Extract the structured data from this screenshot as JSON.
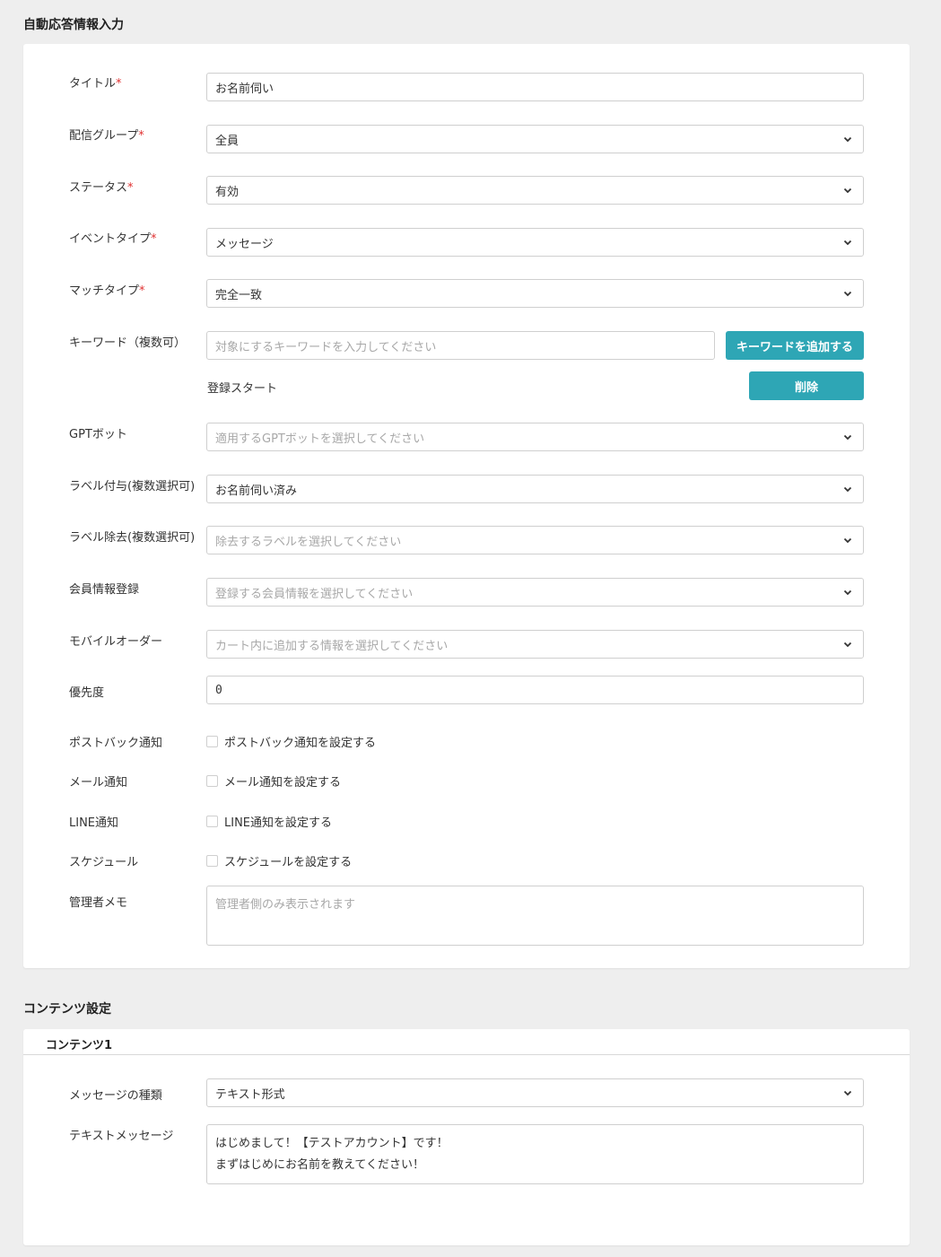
{
  "section1": {
    "title": "自動応答情報入力",
    "title_label": "タイトル",
    "title_value": "お名前伺い",
    "group_label": "配信グループ",
    "group_value": "全員",
    "status_label": "ステータス",
    "status_value": "有効",
    "event_label": "イベントタイプ",
    "event_value": "メッセージ",
    "match_label": "マッチタイプ",
    "match_value": "完全一致",
    "keyword_label": "キーワード（複数可）",
    "keyword_placeholder": "対象にするキーワードを入力してください",
    "keyword_add_button": "キーワードを追加する",
    "keyword_item": "登録スタート",
    "keyword_delete_button": "削除",
    "gpt_label": "GPTボット",
    "gpt_placeholder": "適用するGPTボットを選択してください",
    "label_add_label": "ラベル付与(複数選択可)",
    "label_add_value": "お名前伺い済み",
    "label_remove_label": "ラベル除去(複数選択可)",
    "label_remove_placeholder": "除去するラベルを選択してください",
    "member_label": "会員情報登録",
    "member_placeholder": "登録する会員情報を選択してください",
    "mobile_label": "モバイルオーダー",
    "mobile_placeholder": "カート内に追加する情報を選択してください",
    "priority_label": "優先度",
    "priority_value": "0",
    "postback_label": "ポストバック通知",
    "postback_check": "ポストバック通知を設定する",
    "mail_label": "メール通知",
    "mail_check": "メール通知を設定する",
    "line_label": "LINE通知",
    "line_check": "LINE通知を設定する",
    "schedule_label": "スケジュール",
    "schedule_check": "スケジュールを設定する",
    "memo_label": "管理者メモ",
    "memo_placeholder": "管理者側のみ表示されます",
    "required_mark": "*"
  },
  "section2": {
    "title": "コンテンツ設定",
    "tab_label": "コンテンツ1",
    "msg_type_label": "メッセージの種類",
    "msg_type_value": "テキスト形式",
    "text_label": "テキストメッセージ",
    "text_line1": "はじめまして！【テストアカウント】です！",
    "text_line2": "まずはじめにお名前を教えてください！"
  },
  "colors": {
    "accent": "#2ea6b5",
    "required": "#e03030",
    "background": "#eeeeee"
  },
  "icons": {
    "dropdown": "chevron-down-icon"
  }
}
